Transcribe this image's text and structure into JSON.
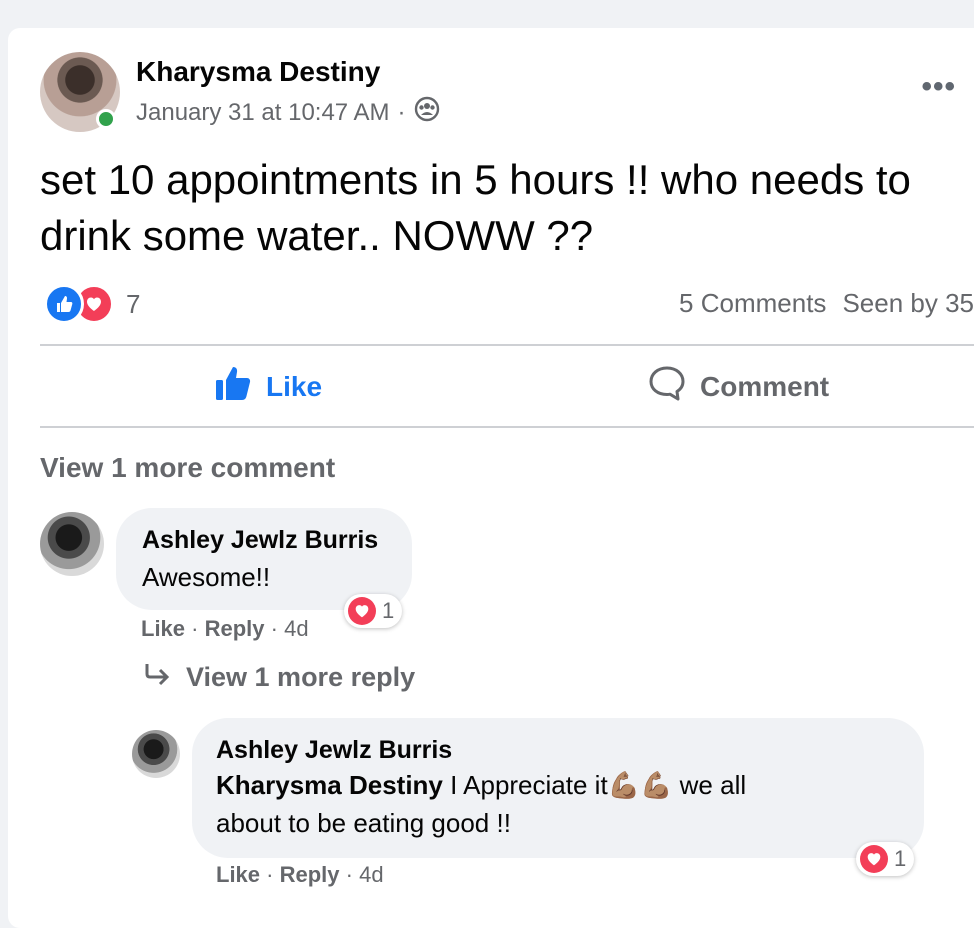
{
  "post": {
    "author": "Kharysma Destiny",
    "timestamp": "January 31 at 10:47 AM",
    "separator": "·",
    "audience_icon": "group-icon",
    "text": "set 10 appointments in 5 hours !! who needs to drink some water.. NOWW ??",
    "reaction_count": "7",
    "comments_count": "5 Comments",
    "seen_by": "Seen by 35"
  },
  "actions": {
    "like_label": "Like",
    "comment_label": "Comment"
  },
  "view_more_comments": "View 1 more comment",
  "comments": [
    {
      "author": "Ashley Jewlz Burris",
      "text": "Awesome!!",
      "like": "Like",
      "reply": "Reply",
      "age": "4d",
      "reaction_count": "1"
    }
  ],
  "view_more_replies": "View 1 more reply",
  "replies": [
    {
      "author": "Ashley Jewlz Burris",
      "mention": "Kharysma Destiny",
      "text_a": "I Appreciate it",
      "emoji": "💪🏽💪🏽",
      "text_b": "we all",
      "text_c": "about to be eating good !!",
      "like": "Like",
      "reply": "Reply",
      "age": "4d",
      "reaction_count": "1"
    }
  ],
  "colors": {
    "accent": "#1877f2",
    "love": "#f33e58",
    "online": "#31a24c",
    "muted": "#65676b",
    "bubble": "#f0f2f5"
  }
}
